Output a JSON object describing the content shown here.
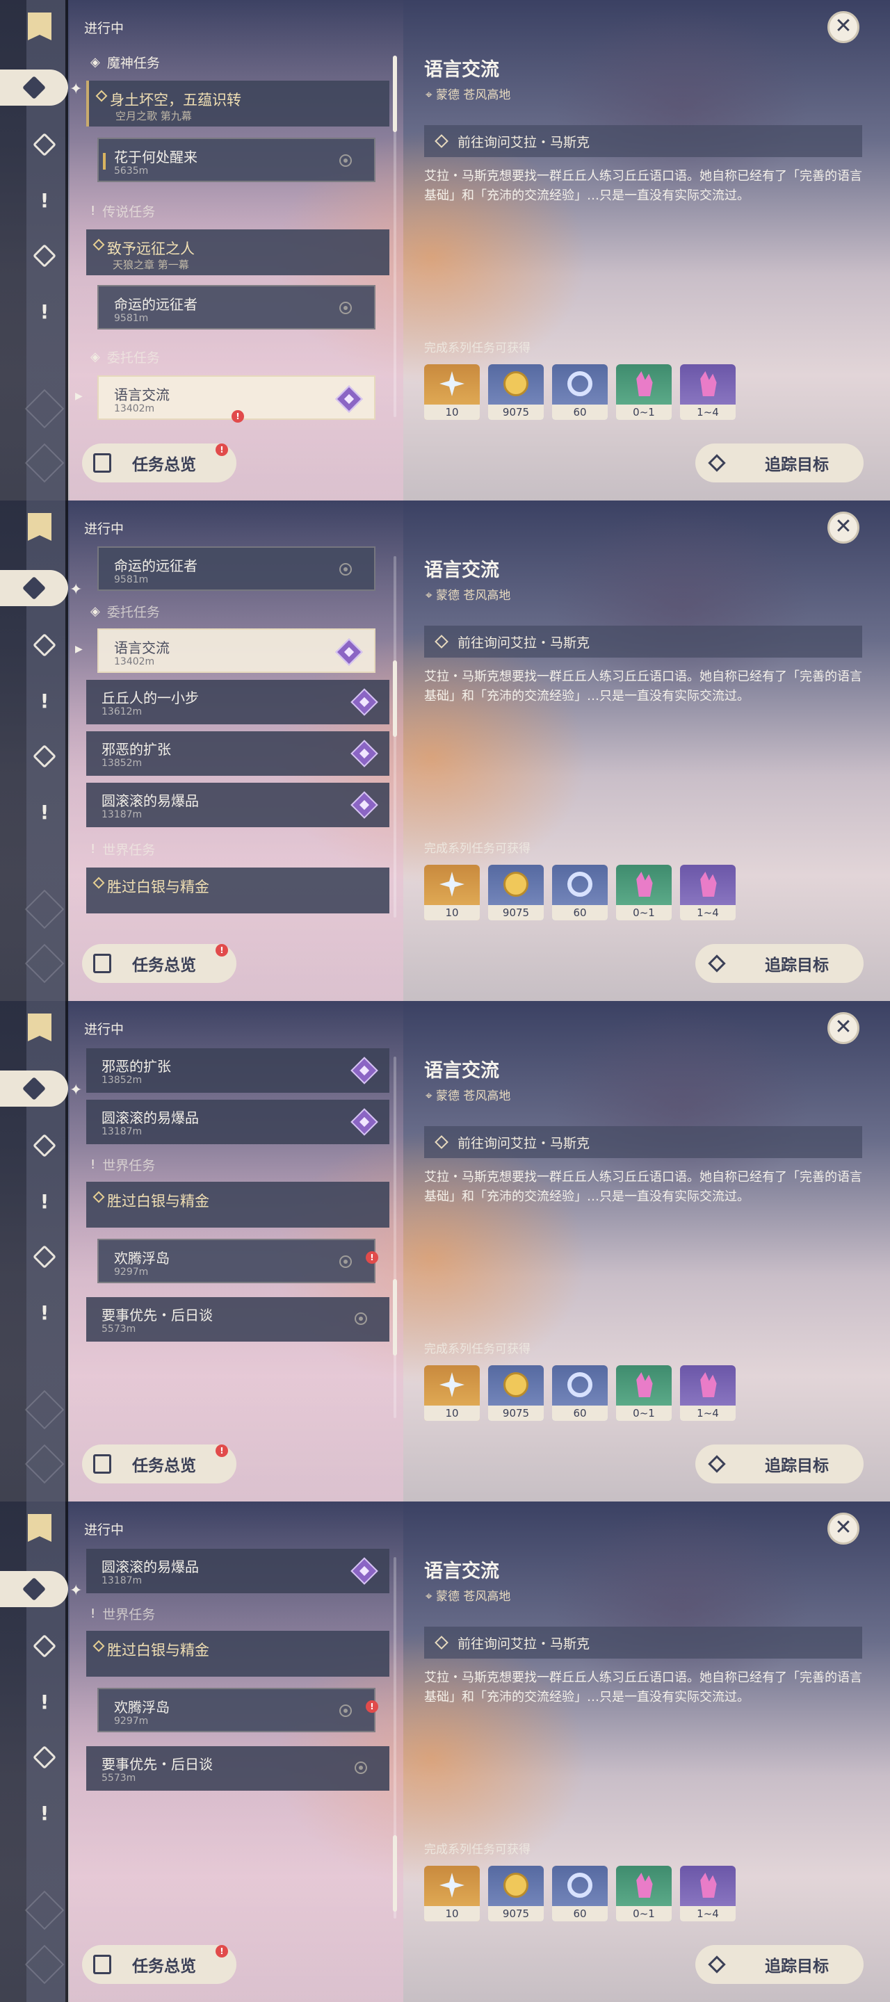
{
  "header": {
    "in_progress": "进行中"
  },
  "details": {
    "title": "语言交流",
    "location": "蒙德 苍风高地",
    "objective": "前往询问艾拉・马斯克",
    "description": "艾拉・马斯克想要找一群丘丘人练习丘丘语口语。她自称已经有了「完善的语言基础」和「充沛的交流经验」…只是一直没有实际交流过。",
    "rewards_label": "完成系列任务可获得",
    "rewards": [
      {
        "icon": "primogem-icon",
        "count": "10",
        "color": "#e7b45c"
      },
      {
        "icon": "mora-icon",
        "count": "9075",
        "color": "#7e8fc3"
      },
      {
        "icon": "companionship-exp-icon",
        "count": "60",
        "color": "#7e8fc3"
      },
      {
        "icon": "crystal-green-icon",
        "count": "0~1",
        "color": "#66b592"
      },
      {
        "icon": "crystal-purple-icon",
        "count": "1~4",
        "color": "#9480c9"
      }
    ]
  },
  "buttons": {
    "overview": "任务总览",
    "track": "追踪目标"
  },
  "groups": {
    "archon": "魔神任务",
    "legend": "传说任务",
    "commission": "委托任务",
    "world": "世界任务"
  },
  "quests": {
    "archon_main": {
      "title": "身土坏空，五蕴识转",
      "sub": "空月之歌 第九幕"
    },
    "archon_step": {
      "title": "花于何处醒来",
      "dist": "5635m"
    },
    "legend_main": {
      "title": "致予远征之人",
      "sub": "天狼之章 第一幕"
    },
    "legend_step": {
      "title": "命运的远征者",
      "dist": "9581m"
    },
    "lang": {
      "title": "语言交流",
      "dist": "13402m"
    },
    "hilichurl": {
      "title": "丘丘人的一小步",
      "dist": "13612m"
    },
    "evil": {
      "title": "邪恶的扩张",
      "dist": "13852m"
    },
    "bomb": {
      "title": "圆滚滚的易爆品",
      "dist": "13187m"
    },
    "silver": {
      "title": "胜过白银与精金"
    },
    "island": {
      "title": "欢腾浮岛",
      "dist": "9297m"
    },
    "priority": {
      "title": "要事优先・后日谈",
      "dist": "5573m"
    }
  },
  "alert_mark": "!"
}
